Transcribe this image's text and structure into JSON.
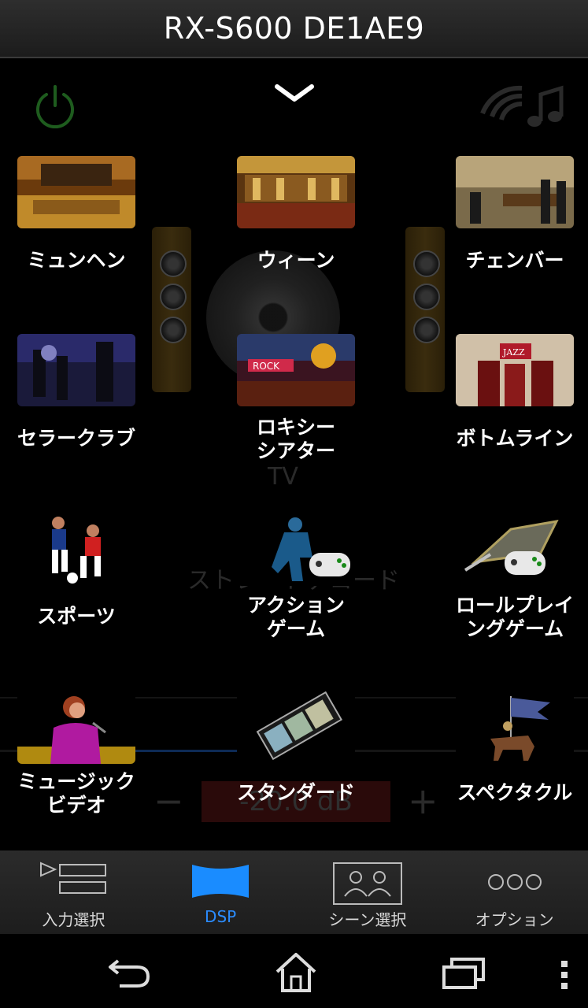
{
  "window": {
    "title": "RX-S600 DE1AE9"
  },
  "background": {
    "input_label": "TV",
    "decode_label": "ストレートデコード",
    "volume_readout": "-20.0 dB"
  },
  "dsp_programs": [
    {
      "label": "ミュンヘン"
    },
    {
      "label": "ウィーン"
    },
    {
      "label": "チェンバー"
    },
    {
      "label": "セラークラブ"
    },
    {
      "label": "ロキシー\nシアター"
    },
    {
      "label": "ボトムライン"
    },
    {
      "label": "スポーツ"
    },
    {
      "label": "アクション\nゲーム"
    },
    {
      "label": "ロールプレイ\nングゲーム"
    },
    {
      "label": "ミュージック\nビデオ"
    },
    {
      "label": "スタンダード"
    },
    {
      "label": "スペクタクル"
    }
  ],
  "tabs": [
    {
      "label": "入力選択",
      "icon": "input-select-icon"
    },
    {
      "label": "DSP",
      "icon": "dsp-icon",
      "active": true
    },
    {
      "label": "シーン選択",
      "icon": "scene-select-icon"
    },
    {
      "label": "オプション",
      "icon": "options-icon"
    }
  ],
  "colors": {
    "accent": "#2b8cff",
    "power": "#1e6b1e"
  }
}
